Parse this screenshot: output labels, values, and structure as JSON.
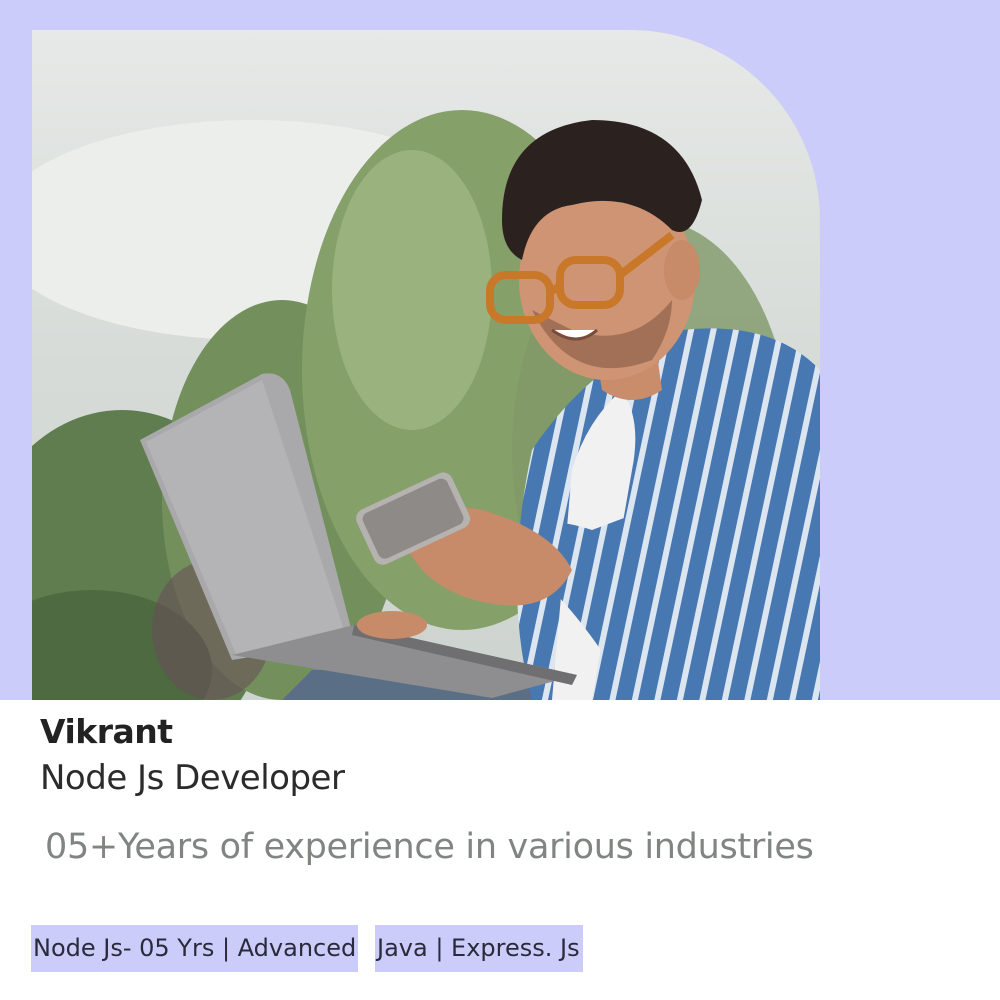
{
  "profile": {
    "name": "Vikrant",
    "role": "Node Js Developer",
    "experience": "05+Years of experience in various industries"
  },
  "skills": [
    "Node Js- 05 Yrs | Advanced",
    "Java | Express. Js"
  ],
  "colors": {
    "accent": "#ccccfb",
    "name_text": "#222222",
    "experience_text": "#808582"
  }
}
